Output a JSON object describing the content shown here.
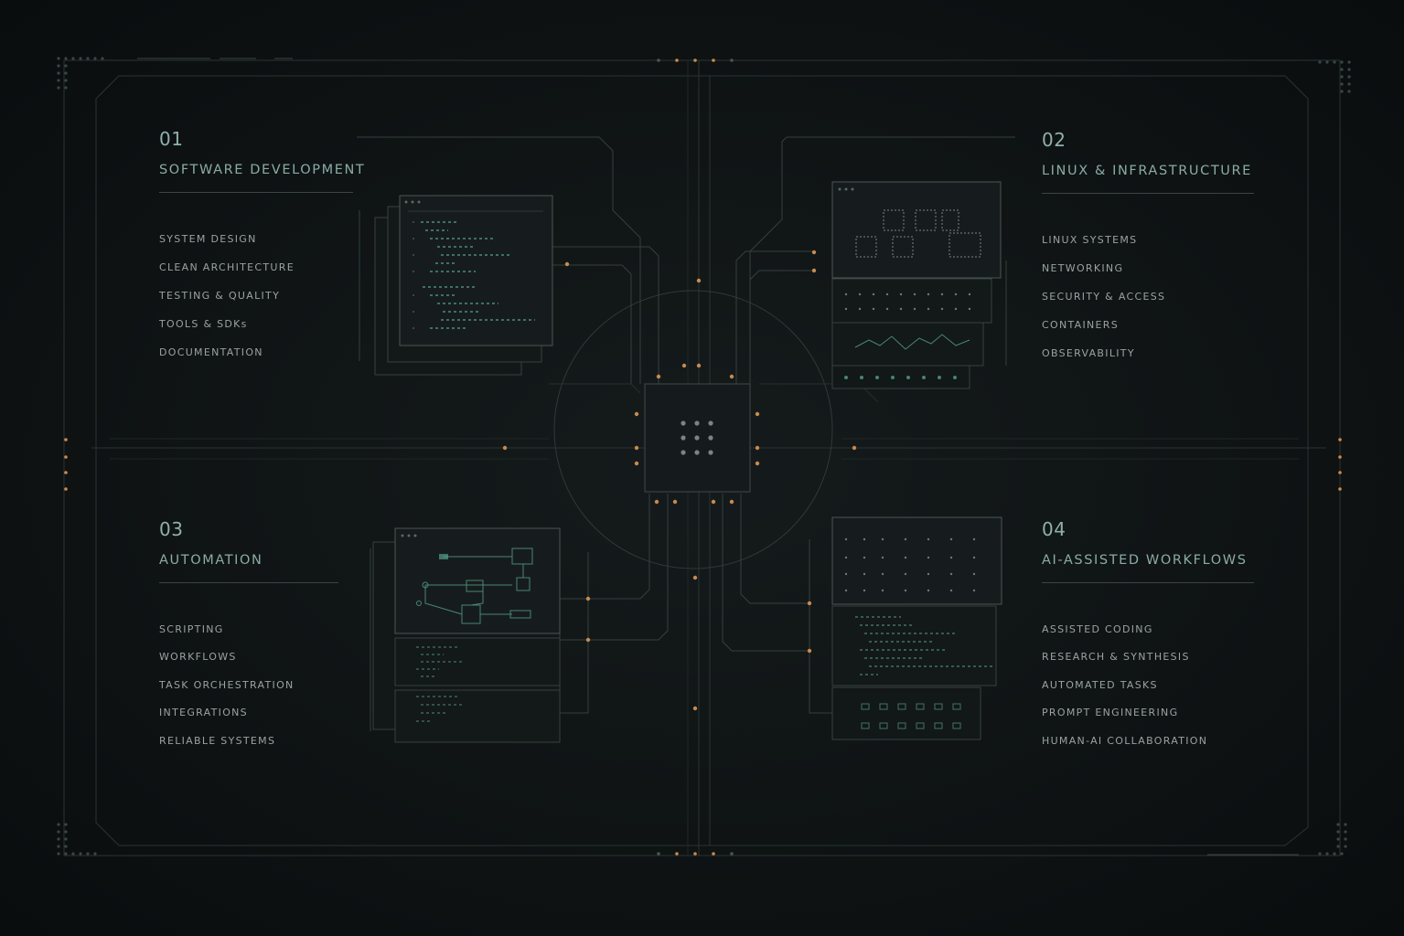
{
  "colors": {
    "background": "#0d1112",
    "line": "#2a3432",
    "accent_orange": "#c98a4e",
    "accent_teal": "#5fb29a",
    "title_teal": "#8aaca6",
    "item_text": "#9aa3a1"
  },
  "center_hub": {
    "icon": "grid-dots-icon"
  },
  "quadrants": [
    {
      "number": "01",
      "title": "SOFTWARE DEVELOPMENT",
      "items": [
        "SYSTEM DESIGN",
        "CLEAN ARCHITECTURE",
        "TESTING & QUALITY",
        "TOOLS & SDKs",
        "DOCUMENTATION"
      ]
    },
    {
      "number": "02",
      "title": "LINUX & INFRASTRUCTURE",
      "items": [
        "LINUX SYSTEMS",
        "NETWORKING",
        "SECURITY & ACCESS",
        "CONTAINERS",
        "OBSERVABILITY"
      ]
    },
    {
      "number": "03",
      "title": "AUTOMATION",
      "items": [
        "SCRIPTING",
        "WORKFLOWS",
        "TASK ORCHESTRATION",
        "INTEGRATIONS",
        "RELIABLE SYSTEMS"
      ]
    },
    {
      "number": "04",
      "title": "AI-ASSISTED WORKFLOWS",
      "items": [
        "ASSISTED CODING",
        "RESEARCH & SYNTHESIS",
        "AUTOMATED TASKS",
        "PROMPT ENGINEERING",
        "HUMAN-AI COLLABORATION"
      ]
    }
  ]
}
